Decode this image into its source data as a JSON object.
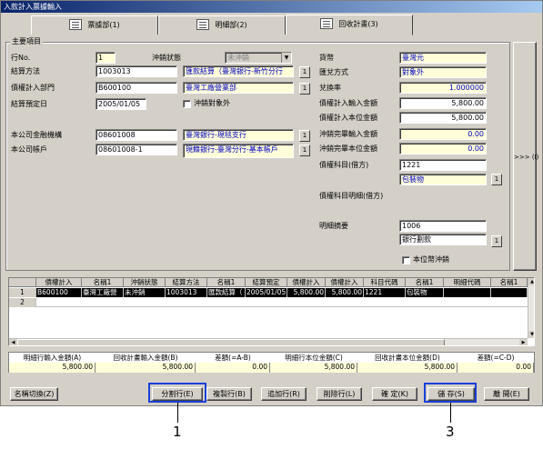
{
  "window": {
    "title": "入款計入票據輸入"
  },
  "tabs": [
    {
      "label": "票據部(1)"
    },
    {
      "label": "明細部(2)"
    },
    {
      "label": "回收計畫(3)"
    }
  ],
  "main_group": {
    "label": "主要項目"
  },
  "fields": {
    "line_no": {
      "label": "行No.",
      "value": "1"
    },
    "offset_status": {
      "label": "沖銷狀態",
      "value": "未沖銷"
    },
    "settlement_method": {
      "label": "結算方法",
      "code": "1003013",
      "name": "匯款結算（臺灣銀行-新竹分行"
    },
    "debtor_dept": {
      "label": "債權計入部門",
      "code": "B600100",
      "name": "臺灣工廠營業部"
    },
    "settlement_date": {
      "label": "結算預定日",
      "value": "2005/01/05"
    },
    "offset_exclude": {
      "label": "沖銷對象外"
    },
    "company_bank": {
      "label": "本公司金融機構",
      "code": "08601008",
      "name": "臺灣銀行-現毯支行"
    },
    "company_account": {
      "label": "本公司帳戶",
      "code": "08601008-1",
      "name": "現籍銀行-臺灣分行-基本帳戶"
    },
    "currency": {
      "label": "貨幣",
      "value": "臺灣元"
    },
    "exchange_method": {
      "label": "匯兌方式",
      "value": "對象外"
    },
    "exchange_rate": {
      "label": "兌換率",
      "value": "1.000000"
    },
    "debt_input_amount": {
      "label": "債權計入輸入金額",
      "value": "5,800.00"
    },
    "debt_local_amount": {
      "label": "債權計入本位金額",
      "value": "5,800.00"
    },
    "offset_input_amount": {
      "label": "沖銷完畢輸入金額",
      "value": "0.00"
    },
    "offset_local_amount": {
      "label": "沖銷完畢本位金額",
      "value": "0.00"
    },
    "debt_subject": {
      "label": "債權科目(借方)",
      "code": "1221",
      "name": "包裝物"
    },
    "debt_subject_detail": {
      "label": "債權科目明細(借方)"
    },
    "detail_summary": {
      "label": "明細摘要",
      "code": "1006",
      "name": "銀行劃款"
    },
    "local_currency_offset": {
      "label": "本位幣沖銷"
    }
  },
  "side_button": {
    "label": ">>> (I)"
  },
  "grid": {
    "headers": [
      "債權計入",
      "名稱1",
      "沖銷狀態",
      "結算方法",
      "名稱1",
      "結算預定",
      "債權計入",
      "債權計入",
      "科目代碼",
      "名稱1",
      "明細代碼",
      "名稱1"
    ],
    "rows": [
      {
        "no": "1",
        "cells": [
          "B600100",
          "臺灣工廠營",
          "未沖銷",
          "1003013",
          "匯款結算（",
          "2005/01/05",
          "5,800.00",
          "5,800.00",
          "1221",
          "包裝物",
          "",
          ""
        ]
      },
      {
        "no": "2",
        "cells": [
          "",
          "",
          "",
          "",
          "",
          "",
          "",
          "",
          "",
          "",
          "",
          ""
        ]
      }
    ]
  },
  "summary": {
    "headers": [
      "明細行輸入金額(A)",
      "回收計畫輸入金額(B)",
      "差額(=A-B)",
      "明細行本位金額(C)",
      "回收計畫本位金額(D)",
      "差額(=C-D)"
    ],
    "values": [
      "5,800.00",
      "5,800.00",
      "0.00",
      "5,800.00",
      "5,800.00",
      "0.00"
    ]
  },
  "buttons": {
    "name_switch": "名稱切換(Z)",
    "split_row": "分割行(E)",
    "copy_row": "複製行(B)",
    "add_row": "追加行(R)",
    "delete_row": "削除行(L)",
    "confirm": "確 定(K)",
    "save": "儲 存(S)",
    "close": "離 開(E)"
  },
  "callouts": {
    "one": "1",
    "three": "3"
  }
}
